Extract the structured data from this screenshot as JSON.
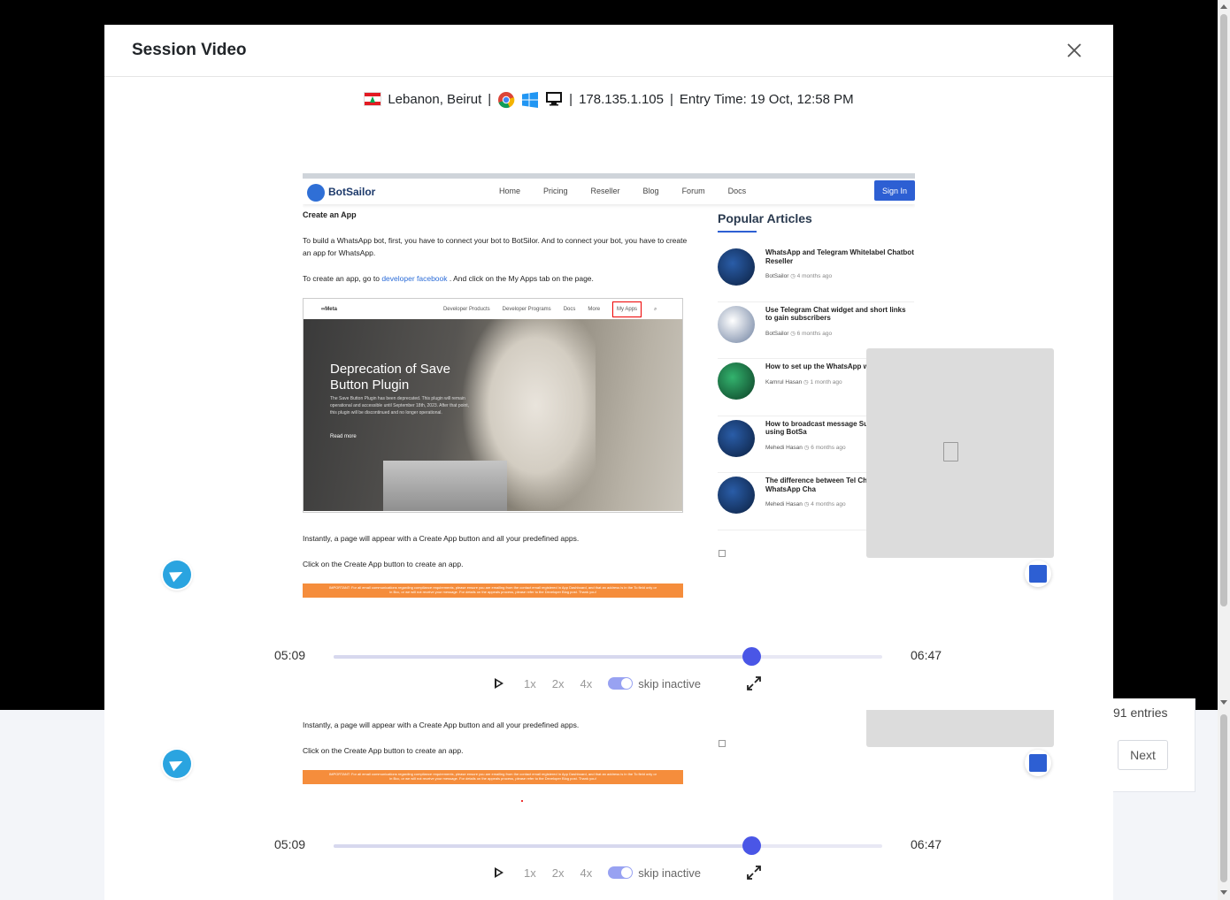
{
  "background": {
    "entries_text": "91 entries",
    "next_label": "Next"
  },
  "modal": {
    "title": "Session Video",
    "close_icon": "close-icon"
  },
  "session_info": {
    "flag_icon": "lebanon-flag-icon",
    "location": "Lebanon, Beirut",
    "browser_icon": "chrome-icon",
    "os_icon": "windows-icon",
    "device_icon": "desktop-icon",
    "ip": "178.135.1.105",
    "entry_time": "Entry Time: 19 Oct, 12:58 PM",
    "separator": "|"
  },
  "replay_page": {
    "logo": "BotSailor",
    "nav": [
      "Home",
      "Pricing",
      "Reseller",
      "Blog",
      "Forum",
      "Docs"
    ],
    "sign_in": "Sign In",
    "article": {
      "heading": "Create an App",
      "p1": "To build a WhatsApp bot, first, you have to connect your bot to BotSilor. And to connect your bot, you have to create an app for WhatsApp.",
      "p2_before": "To create an app, go to ",
      "p2_link": "developer facebook",
      "p2_after": " . And click on the My Apps tab on the page.",
      "meta_logo": "∞Meta",
      "meta_nav": [
        "Developer Products",
        "Developer Programs",
        "Docs",
        "More"
      ],
      "meta_myapps": "My Apps",
      "meta_heading": "Deprecation of Save Button Plugin",
      "meta_sub": "The Save Button Plugin has been deprecated. This plugin will remain operational and accessible until September 18th, 2023. After that point, this plugin will be discontinued and no longer operational.",
      "meta_read": "Read more",
      "p3": "Instantly, a page will appear with a Create App button and all your predefined apps.",
      "p4": "Click on the Create App button to create an app.",
      "banner": "IMPORTANT: For all email communications regarding compliance requirements, please ensure you are emailing from the contact email registered in App Dashboard, and that an address is in the To field only or in Bcc, or we will not receive your message. For details on the appeals process, please refer to the Developer Blog post. Thank you!"
    },
    "popular": {
      "title": "Popular Articles",
      "items": [
        {
          "title": "WhatsApp and Telegram Whitelabel Chatbot Reseller",
          "author": "BotSailor",
          "age": "4 months ago"
        },
        {
          "title": "Use Telegram Chat widget and short links to gain subscribers",
          "author": "BotSailor",
          "age": "6 months ago"
        },
        {
          "title": "How to set up the WhatsApp with BotSailor",
          "author": "Kamrul Hasan",
          "age": "1 month ago"
        },
        {
          "title": "How to broadcast message Subscribers by using BotSa",
          "author": "Mehedi Hasan",
          "age": "6 months ago"
        },
        {
          "title": "The difference between Tel Chatbot and WhatsApp Cha",
          "author": "Mehedi Hasan",
          "age": "4 months ago"
        }
      ]
    }
  },
  "player": {
    "current_time": "05:09",
    "total_time": "06:47",
    "progress": 0.762,
    "speeds": [
      "1x",
      "2x",
      "4x"
    ],
    "skip_label": "skip inactive",
    "skip_inactive_on": true,
    "play_icon": "play-icon",
    "fullscreen_icon": "expand-icon"
  }
}
